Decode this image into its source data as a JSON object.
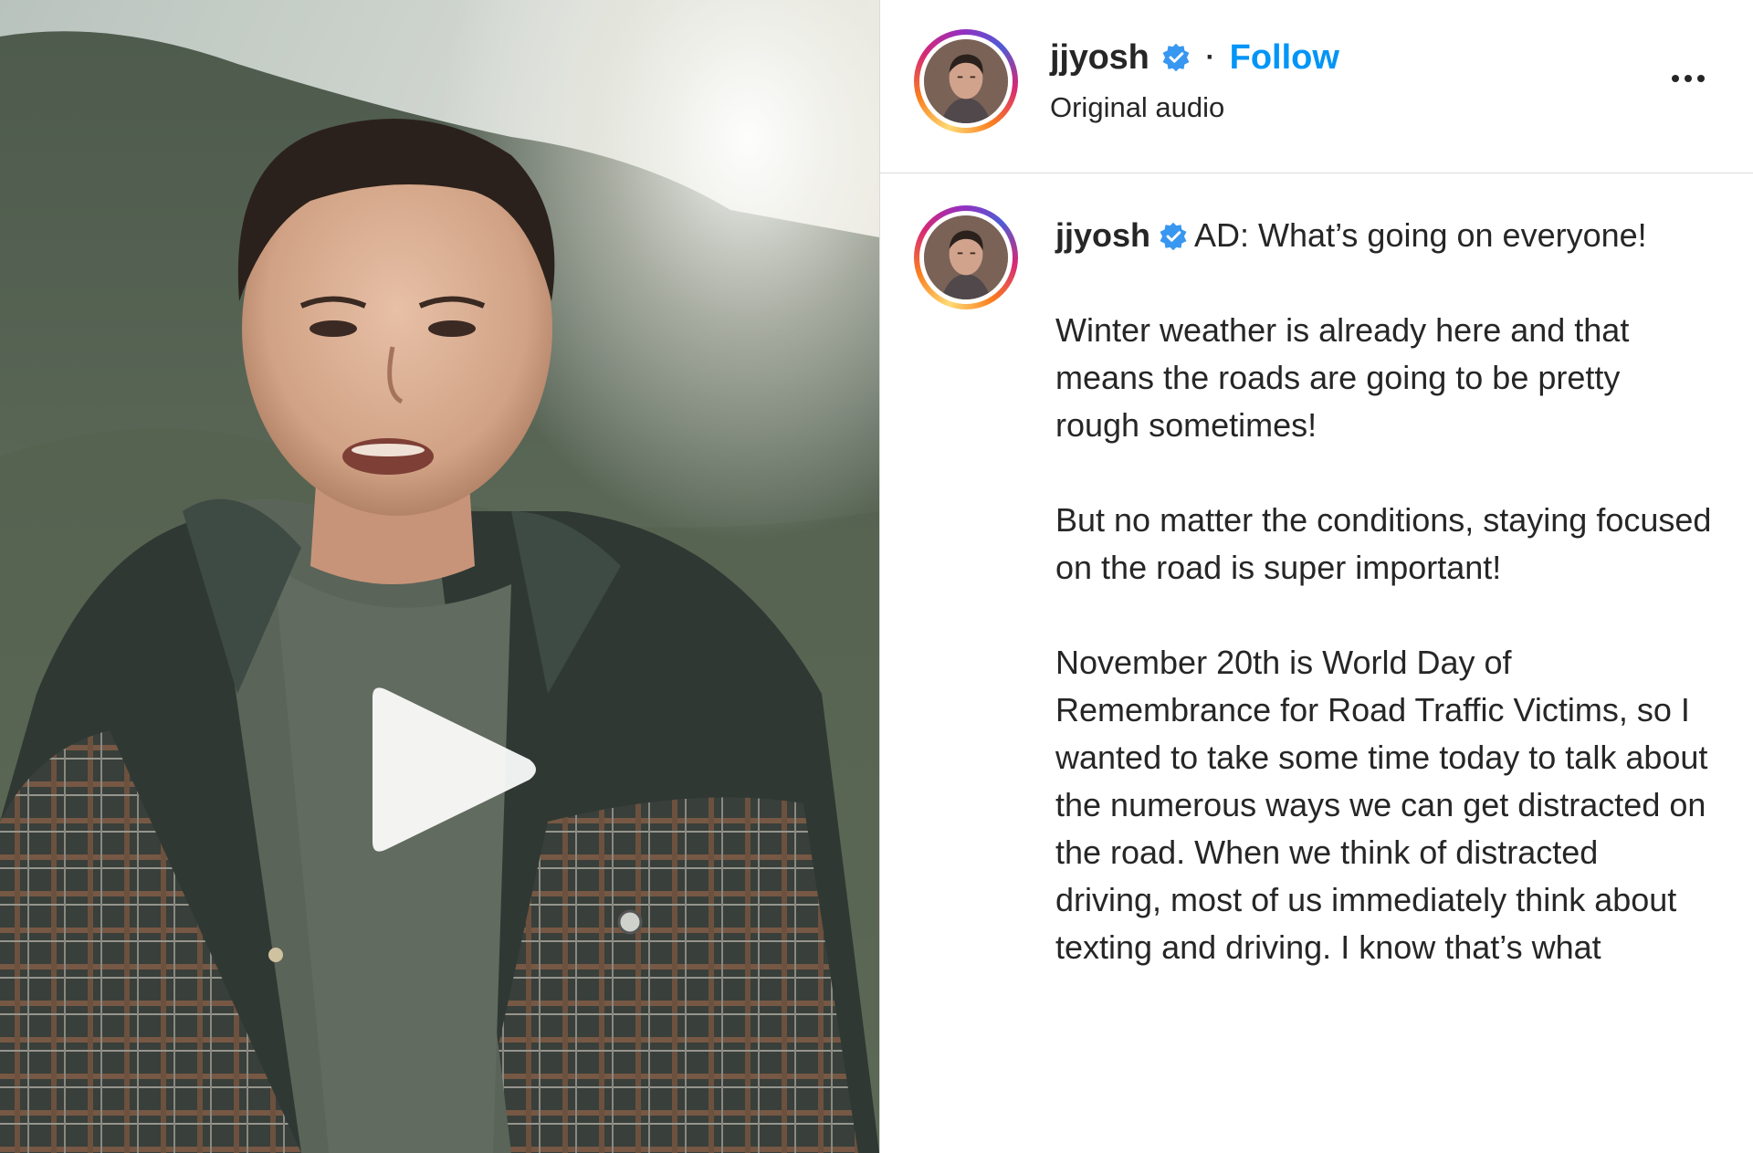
{
  "header": {
    "username": "jjyosh",
    "separator": "·",
    "follow_label": "Follow",
    "audio_label": "Original audio"
  },
  "caption": {
    "username": "jjyosh",
    "paragraphs": [
      "AD: What’s going on everyone!",
      "Winter weather is already here and that means the roads are going to be pretty rough sometimes!",
      "But no matter the conditions, staying focused on the road is super important!",
      "November 20th is World Day of Remembrance for Road Traffic Victims, so I wanted to take some time today to talk about the numerous ways we can get distracted on the road. When we think of distracted driving, most of us immediately think about texting and driving. I know that’s what"
    ]
  },
  "colors": {
    "follow_blue": "#0095f6",
    "verified_blue": "#3897f0",
    "text": "#262626",
    "divider": "#dbdbdb"
  },
  "icons": {
    "verified": "verified-badge-icon",
    "more": "more-options-icon",
    "play": "play-icon"
  }
}
